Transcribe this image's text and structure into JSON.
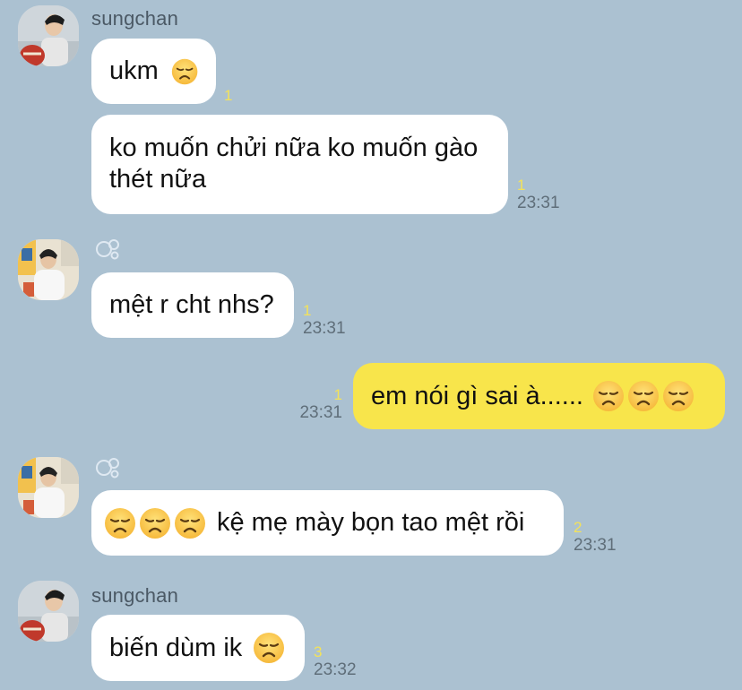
{
  "messages": [
    {
      "sender": "sungchan",
      "text": "ukm",
      "unread": "1",
      "time": ""
    },
    {
      "text_line1": "ko muốn chửi nữa ko muốn gào",
      "text_line2": "thét nữa",
      "unread": "1",
      "time": "23:31"
    },
    {
      "text": "mệt r cht nhs?",
      "unread": "1",
      "time": "23:31"
    },
    {
      "text": "em nói gì sai à......",
      "unread": "1",
      "time": "23:31",
      "mine": true
    },
    {
      "text": "kệ mẹ mày bọn tao mệt rồi",
      "unread": "2",
      "time": "23:31"
    },
    {
      "sender": "sungchan",
      "text": "biến dùm ik",
      "unread": "3",
      "time": "23:32"
    }
  ],
  "colors": {
    "background": "#abc1d1",
    "incoming_bubble": "#ffffff",
    "outgoing_bubble": "#f8e54b",
    "unread_count": "#f3e25a",
    "timestamp": "#5f6e79"
  },
  "icons": {
    "emoji": "disappointed-face-emoji",
    "status": "bubbles-icon"
  }
}
